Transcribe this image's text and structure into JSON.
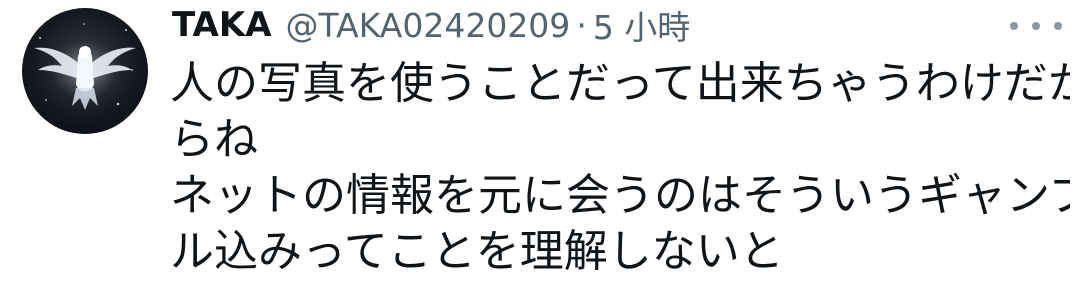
{
  "tweet": {
    "author": {
      "display_name": "TAKA",
      "handle": "@TAKA02420209",
      "avatar_icon": "eagle-avatar-icon"
    },
    "separator": "·",
    "time": "5 小時",
    "more_icon": "more-options-icon",
    "text_lines": [
      "人の写真を使うことだって出来ちゃうわけだか",
      "らね",
      "ネットの情報を元に会うのはそういうギャンブ",
      "ル込みってことを理解しないと"
    ]
  },
  "colors": {
    "primary_text": "#0f1419",
    "secondary_text": "#536471",
    "more_icon": "#8b98a5",
    "background": "#ffffff"
  }
}
